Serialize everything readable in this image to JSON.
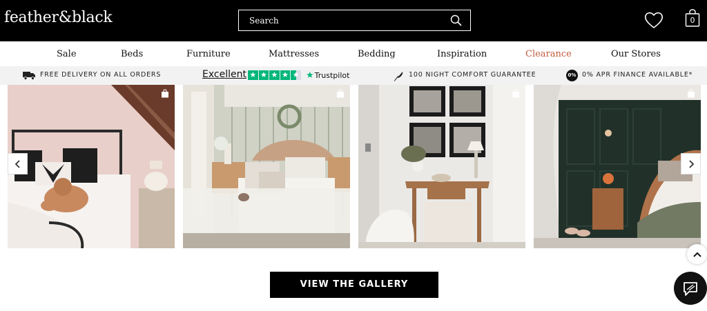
{
  "header": {
    "logo_text": "feather&black",
    "search_placeholder": "Search",
    "basket_count": "0"
  },
  "nav": {
    "items": [
      {
        "label": "Sale"
      },
      {
        "label": "Beds"
      },
      {
        "label": "Furniture"
      },
      {
        "label": "Mattresses"
      },
      {
        "label": "Bedding"
      },
      {
        "label": "Inspiration"
      },
      {
        "label": "Clearance"
      },
      {
        "label": "Our Stores"
      }
    ],
    "clearance_color": "#c05a3c"
  },
  "usp": {
    "delivery": "FREE DELIVERY ON ALL ORDERS",
    "trustpilot_rating": "Excellent",
    "trustpilot_brand": "Trustpilot",
    "trustpilot_stars": 4.5,
    "guarantee": "100 NIGHT COMFORT GUARANTEE",
    "finance_badge": "0%",
    "finance": "0% APR FINANCE AVAILABLE*"
  },
  "gallery": {
    "cta_label": "VIEW THE GALLERY",
    "tiles": [
      {
        "name": "pink-bedroom-metal-bed"
      },
      {
        "name": "sage-panelled-bedroom"
      },
      {
        "name": "console-table-framed-prints"
      },
      {
        "name": "dark-green-panelled-bedroom"
      }
    ]
  },
  "colors": {
    "header_bg": "#000000",
    "accent_clearance": "#c05a3c",
    "trustpilot_green": "#00b67a"
  }
}
